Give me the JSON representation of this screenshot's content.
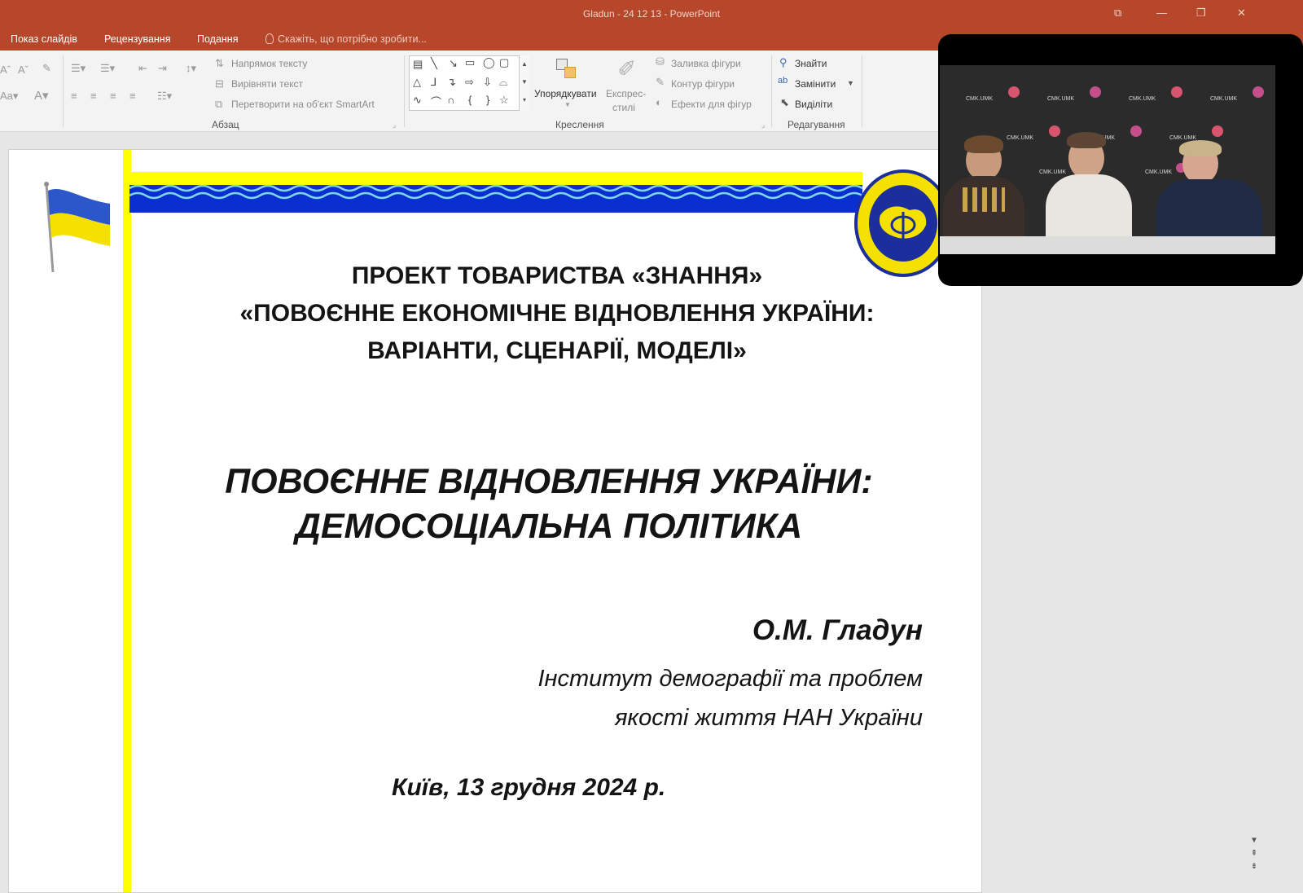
{
  "window": {
    "title": "Gladun - 24 12 13 - PowerPoint",
    "controls": [
      "⧉",
      "—",
      "❐",
      "✕"
    ]
  },
  "menu": {
    "tabs": [
      "Показ слайдів",
      "Рецензування",
      "Подання"
    ],
    "tell_me": "Скажіть, що потрібно зробити..."
  },
  "ribbon": {
    "paragraph": {
      "text_direction": "Напрямок тексту",
      "align_text": "Вирівняти текст",
      "convert_smartart": "Перетворити на об'єкт SmartArt",
      "label": "Абзац"
    },
    "drawing": {
      "arrange": "Упорядкувати",
      "quick_styles_1": "Експрес-",
      "quick_styles_2": "стилі",
      "shape_fill": "Заливка фігури",
      "shape_outline": "Контур фігури",
      "shape_effects": "Ефекти для фігур",
      "label": "Креслення"
    },
    "editing": {
      "find": "Знайти",
      "replace": "Замінити",
      "select": "Виділіти",
      "label": "Редагування"
    }
  },
  "slide": {
    "project_line1": "ПРОЕКТ ТОВАРИСТВА «ЗНАННЯ»",
    "project_line2": "«ПОВОЄННЕ ЕКОНОМІЧНЕ ВІДНОВЛЕННЯ УКРАЇНИ:",
    "project_line3": "ВАРІАНТИ, СЦЕНАРІЇ, МОДЕЛІ»",
    "title_line1": "ПОВОЄННЕ ВІДНОВЛЕННЯ УКРАЇНИ:",
    "title_line2": "ДЕМОСОЦІАЛЬНА ПОЛІТИКА",
    "author": "О.М. Гладун",
    "institute_line1": "Інститут демографії та проблем",
    "institute_line2": "якості життя НАН України",
    "date": "Київ, 13 грудня 2024 р."
  },
  "video": {
    "backdrop_logo": "CMK.UMK"
  },
  "colors": {
    "titlebar": "#b7472a",
    "flag_blue": "#2b57c9",
    "flag_yellow": "#f4e100",
    "accent_yellow": "#ffff00",
    "wave_blue": "#0a2fd0"
  }
}
